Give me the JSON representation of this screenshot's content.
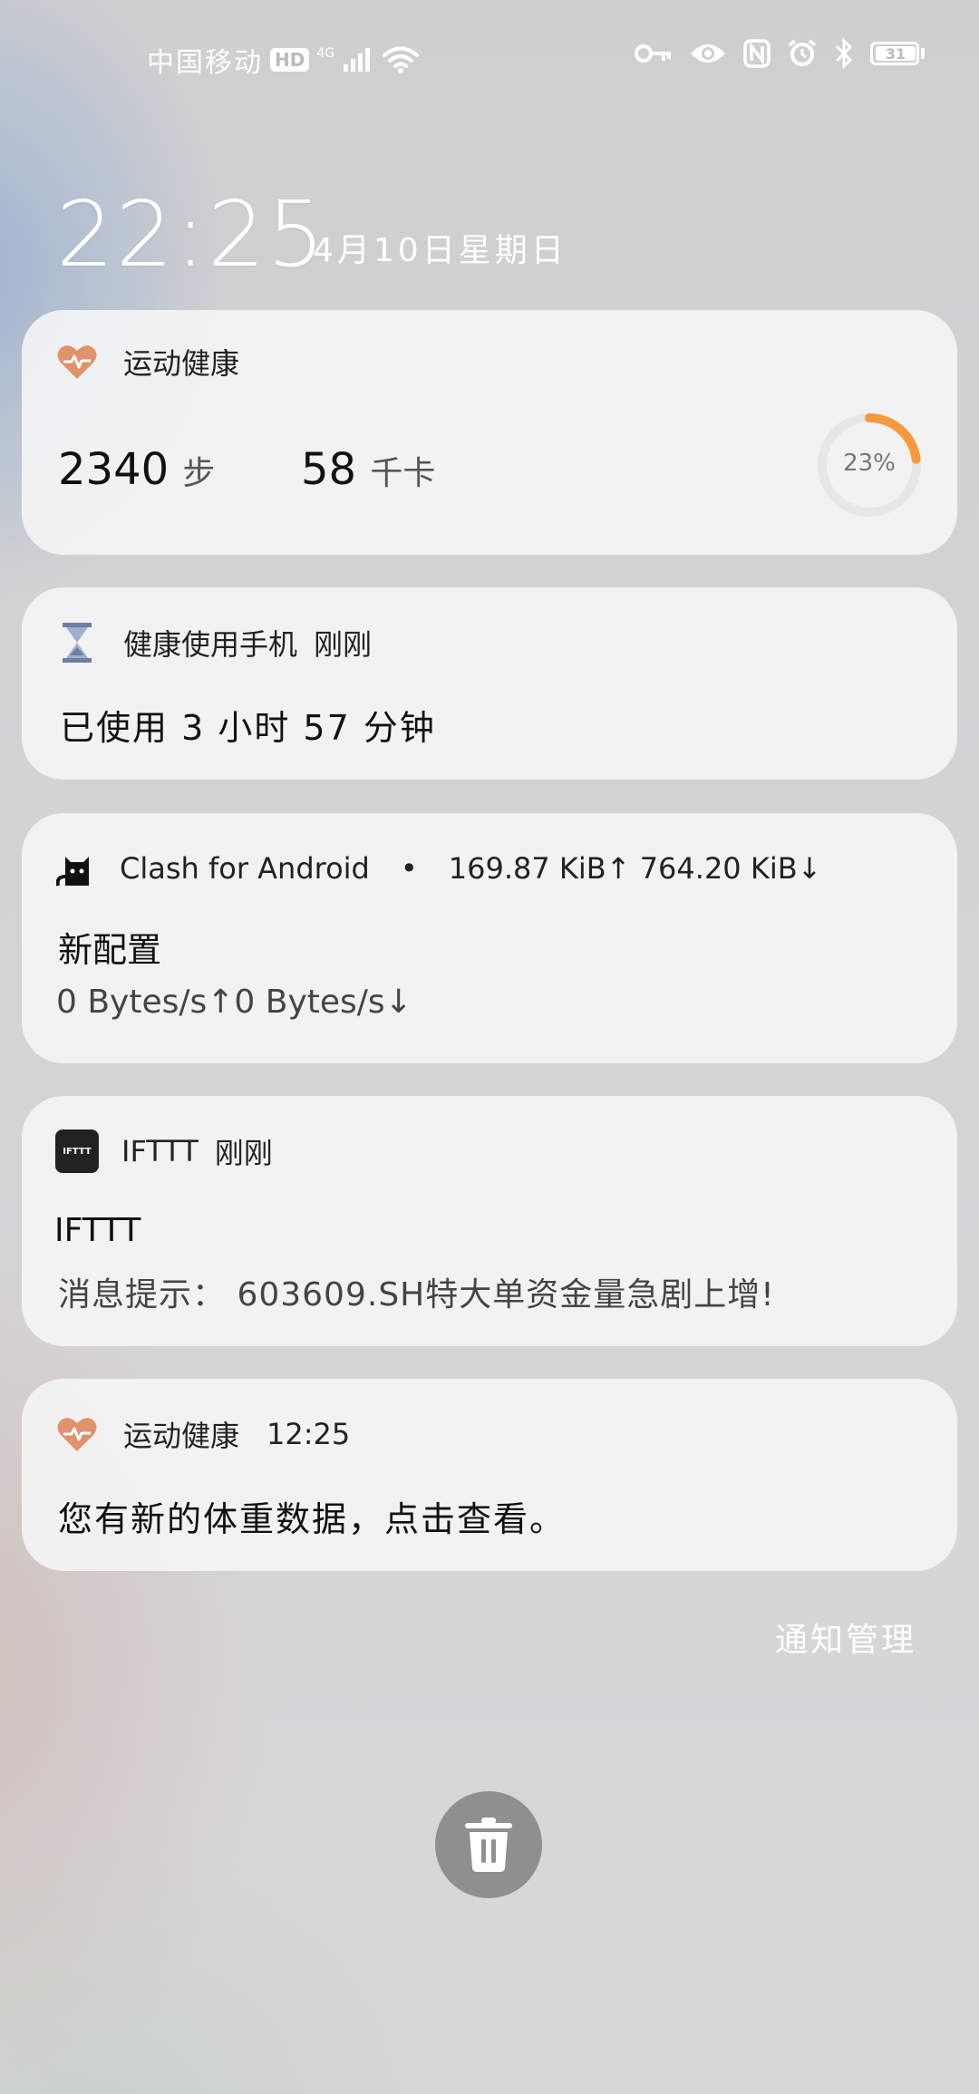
{
  "status_bar": {
    "carrier": "中国移动",
    "hd_badge": "HD",
    "network": "4G",
    "battery": "31"
  },
  "lockscreen": {
    "time": "22:25",
    "date": "4月10日星期日"
  },
  "notifications": [
    {
      "app": "运动健康",
      "steps_value": "2340",
      "steps_unit": "步",
      "calories_value": "58",
      "calories_unit": "千卡",
      "progress_label": "23%",
      "progress": 0.23
    },
    {
      "app": "健康使用手机",
      "time": "刚刚",
      "body": "已使用 3 小时 57 分钟"
    },
    {
      "app": "Clash for Android",
      "separator": "•",
      "traffic": "169.87 KiB↑ 764.20 KiB↓",
      "title": "新配置",
      "body": "0 Bytes/s↑0 Bytes/s↓"
    },
    {
      "app": "IFTTT",
      "time": "刚刚",
      "icon_text": "IFTTT",
      "title": "IFTTT",
      "body": "消息提示： 603609.SH特大单资金量急剧上增!"
    },
    {
      "app": "运动健康",
      "time": "12:25",
      "body": "您有新的体重数据，点击查看。"
    }
  ],
  "notification_manage": "通知管理",
  "colors": {
    "health_heart": "#e0926b",
    "progress_arc": "#f59a3c",
    "hourglass": "#6b7fa3",
    "trash_bg": "#8f8f8f"
  },
  "icons": [
    "key-icon",
    "eye-icon",
    "nfc-icon",
    "alarm-icon",
    "bluetooth-icon",
    "battery-icon",
    "wifi-icon",
    "signal-icon",
    "heart-icon",
    "hourglass-icon",
    "cat-icon",
    "ifttt-icon",
    "trash-icon"
  ]
}
